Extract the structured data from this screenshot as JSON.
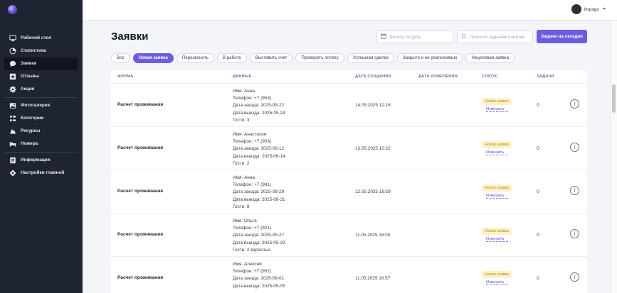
{
  "sidebar": {
    "items": [
      {
        "label": "Рабочий стол",
        "icon": "monitor-icon"
      },
      {
        "label": "Статистика",
        "icon": "pie-chart-icon"
      },
      {
        "label": "Заявки",
        "icon": "chat-bubble-icon",
        "active": true
      },
      {
        "label": "Отзывы",
        "icon": "star-square-icon"
      },
      {
        "label": "Акция",
        "icon": "gear-percent-icon"
      },
      {
        "label": "Фотогалерея",
        "icon": "photo-icon"
      },
      {
        "label": "Категории",
        "icon": "categories-icon"
      },
      {
        "label": "Ресурсы",
        "icon": "resources-icon"
      },
      {
        "label": "Номера",
        "icon": "bed-icon"
      },
      {
        "label": "Информация",
        "icon": "info-doc-icon"
      },
      {
        "label": "Настройки главной",
        "icon": "settings-diamond-icon"
      }
    ]
  },
  "header": {
    "user_name": "impago",
    "accent_color": "#6d5ce0"
  },
  "main": {
    "title": "Заявки",
    "date_filter_placeholder": "Фильтр по дате",
    "search_placeholder": "Поиск по задачам и контак",
    "today_button": "Задачи на сегодня",
    "tabs": [
      "Все",
      "Новая заявка",
      "Перезвонить",
      "В работе",
      "Выставить счет",
      "Проверить оплату",
      "Успешная сделка",
      "Закрыто и не реализовано",
      "Нецелевая заявка"
    ],
    "active_tab": "Новая заявка",
    "columns": {
      "form": "ФОРМА",
      "data": "ДАННЫЕ",
      "created": "ДАТА СОЗДАНИЯ",
      "modified": "ДАТА ИЗМЕНЕНИЯ",
      "status": "СТАТУС",
      "tasks": "ЗАДАЧИ"
    },
    "rows": [
      {
        "form": "Расчет проживания",
        "data": [
          "Имя: Анна",
          "Телефон: +7 (953)",
          "Дата заезда: 2025-05-22",
          "Дата выезда: 2025-05-24",
          "Гости: 3"
        ],
        "created": "14.05.2025 12:16",
        "status": "Новая заявка",
        "change": "Изменить",
        "tasks": "0"
      },
      {
        "form": "Расчет проживания",
        "data": [
          "Имя: Анастасия",
          "Телефон: +7 (903)",
          "Дата заезда: 2025-06-12",
          "Дата выезда: 2025-06-14",
          "Гости: 2"
        ],
        "created": "13.05.2025 10:22",
        "status": "Новая заявка",
        "change": "Изменить",
        "tasks": "0"
      },
      {
        "form": "Расчет проживания",
        "data": [
          "Имя: Анна",
          "Телефон: +7 (981)",
          "Дата заезда: 2025-08-29",
          "Дата выезда: 2025-08-31",
          "Гости: 8"
        ],
        "created": "12.05.2025 18:59",
        "status": "Новая заявка",
        "change": "Изменить",
        "tasks": "0"
      },
      {
        "form": "Расчет проживания",
        "data": [
          "Имя: Ольга",
          "Телефон: +7 (921)",
          "Дата заезда: 2025-05-27",
          "Дата выезда: 2025-05-29",
          "Гости: 2 взрослых"
        ],
        "created": "11.05.2025 18:05",
        "status": "Новая заявка",
        "change": "Изменить",
        "tasks": "0"
      },
      {
        "form": "Расчет проживания",
        "data": [
          "Имя: Алексей",
          "Телефон: +7 (952)",
          "Дата заезда: 2025-08-01",
          "Дата выезда: 2025-05-05"
        ],
        "created": "11.05.2025 16:57",
        "status": "Новая заявка",
        "change": "Изменить",
        "tasks": "0"
      }
    ]
  }
}
